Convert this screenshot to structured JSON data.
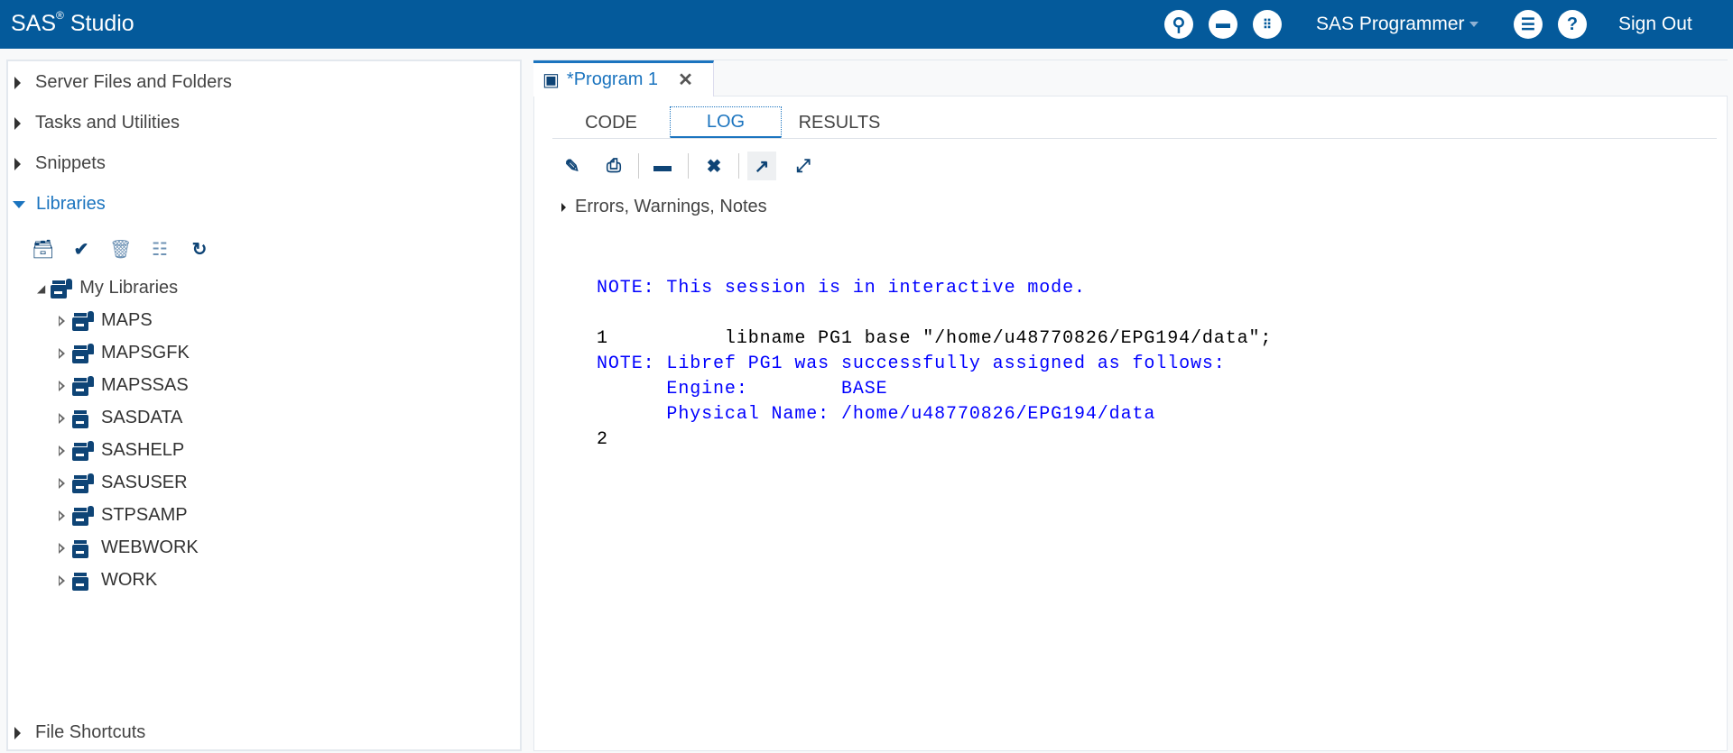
{
  "header": {
    "brand": "SAS",
    "brand_mark": "®",
    "brand_suffix": "Studio",
    "role": "SAS Programmer",
    "sign_out": "Sign Out",
    "icons": [
      "search-icon",
      "open-folder-icon",
      "apps-icon",
      "menu-icon",
      "help-icon"
    ]
  },
  "sidebar": {
    "sections": [
      {
        "label": "Server Files and Folders"
      },
      {
        "label": "Tasks and Utilities"
      },
      {
        "label": "Snippets"
      },
      {
        "label": "Libraries"
      },
      {
        "label": "File Shortcuts"
      }
    ],
    "library_root": "My Libraries",
    "libraries": [
      {
        "name": "MAPS",
        "locked": true
      },
      {
        "name": "MAPSGFK",
        "locked": true
      },
      {
        "name": "MAPSSAS",
        "locked": true
      },
      {
        "name": "SASDATA",
        "locked": false
      },
      {
        "name": "SASHELP",
        "locked": true
      },
      {
        "name": "SASUSER",
        "locked": true
      },
      {
        "name": "STPSAMP",
        "locked": true
      },
      {
        "name": "WEBWORK",
        "locked": false
      },
      {
        "name": "WORK",
        "locked": false
      }
    ]
  },
  "editor": {
    "tab_label": "*Program 1",
    "subtabs": [
      "CODE",
      "LOG",
      "RESULTS"
    ],
    "active_subtab": "LOG",
    "filter_label": "Errors, Warnings, Notes",
    "log": [
      {
        "type": "note",
        "text": "NOTE: This session is in interactive mode."
      },
      {
        "type": "blank",
        "text": " "
      },
      {
        "type": "src",
        "text": "1          libname PG1 base \"/home/u48770826/EPG194/data\";"
      },
      {
        "type": "note",
        "text": "NOTE: Libref PG1 was successfully assigned as follows: "
      },
      {
        "type": "note",
        "text": "      Engine:        BASE "
      },
      {
        "type": "note",
        "text": "      Physical Name: /home/u48770826/EPG194/data"
      },
      {
        "type": "src",
        "text": "2          "
      }
    ]
  },
  "colors": {
    "header": "#045a9b",
    "accent": "#1b74bf",
    "note": "#0000ff",
    "icon": "#0e4476"
  }
}
